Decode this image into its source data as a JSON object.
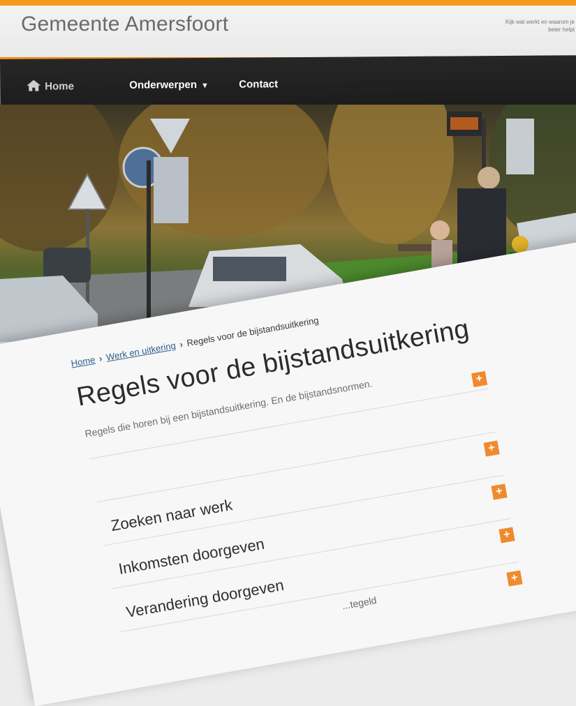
{
  "header": {
    "logo": "Gemeente Amersfoort",
    "note": "Kijk wat werkt en waarom je beter helpt"
  },
  "nav": {
    "home": "Home",
    "topics": "Onderwerpen",
    "contact": "Contact"
  },
  "breadcrumb": {
    "home": "Home",
    "section": "Werk en uitkering",
    "current": "Regels voor de bijstandsuitkering"
  },
  "page": {
    "title": "Regels voor de bijstandsuitkering",
    "intro": "Regels die horen bij een bijstandsuitkering. En de bijstandsnormen."
  },
  "list": [
    {
      "label": ""
    },
    {
      "label": "Zoeken naar werk"
    },
    {
      "label": "Inkomsten doorgeven"
    },
    {
      "label": "Verandering doorgeven"
    },
    {
      "label": "...tegeld"
    }
  ],
  "colors": {
    "accent": "#f08a16",
    "nav_bg": "#1f1f1f",
    "link": "#2f5f8a"
  },
  "icons": {
    "home": "home-icon",
    "dropdown": "chevron-down-icon",
    "expand": "plus-icon"
  }
}
